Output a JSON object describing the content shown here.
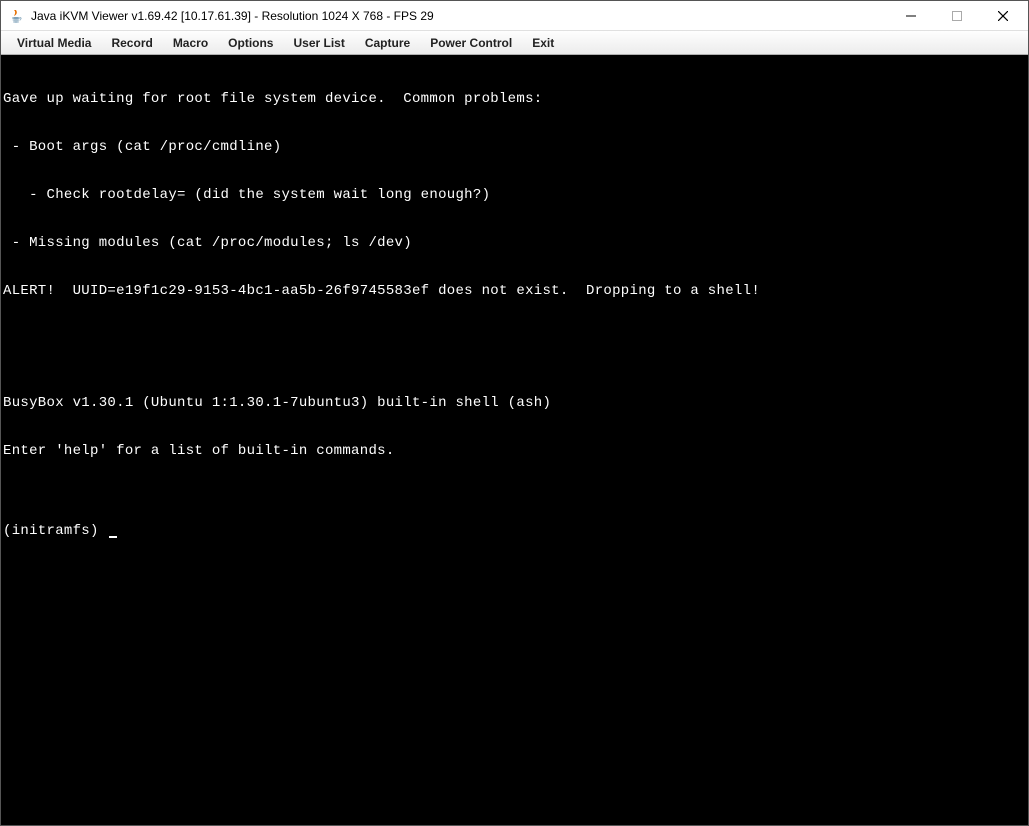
{
  "titlebar": {
    "title": "Java iKVM Viewer v1.69.42 [10.17.61.39]  - Resolution 1024 X 768 - FPS 29"
  },
  "menubar": {
    "items": [
      "Virtual Media",
      "Record",
      "Macro",
      "Options",
      "User List",
      "Capture",
      "Power Control",
      "Exit"
    ]
  },
  "console": {
    "lines": [
      "Gave up waiting for root file system device.  Common problems:",
      " - Boot args (cat /proc/cmdline)",
      "   - Check rootdelay= (did the system wait long enough?)",
      " - Missing modules (cat /proc/modules; ls /dev)",
      "ALERT!  UUID=e19f1c29-9153-4bc1-aa5b-26f9745583ef does not exist.  Dropping to a shell!",
      "",
      "",
      "BusyBox v1.30.1 (Ubuntu 1:1.30.1-7ubuntu3) built-in shell (ash)",
      "Enter 'help' for a list of built-in commands.",
      ""
    ],
    "prompt": "(initramfs) "
  }
}
